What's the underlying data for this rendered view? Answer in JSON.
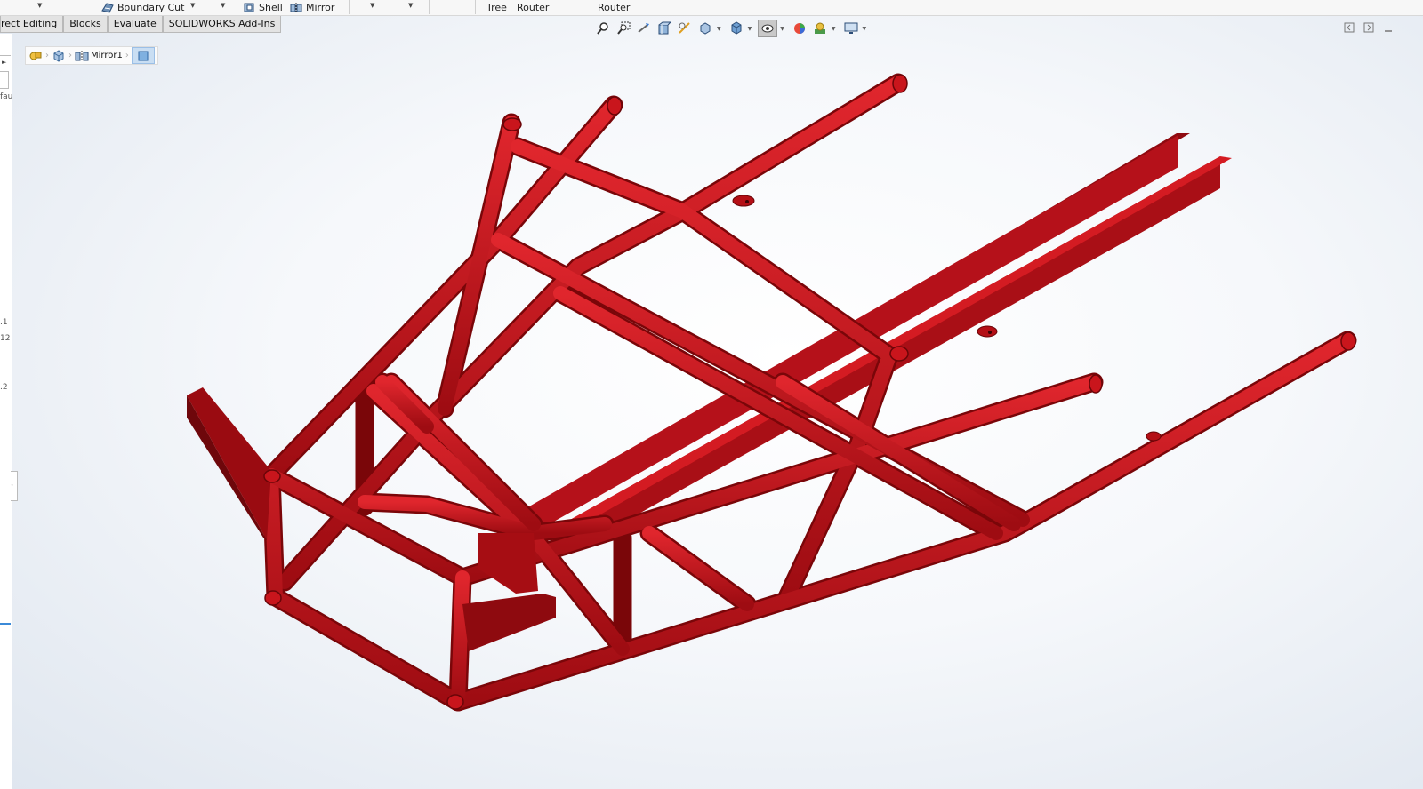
{
  "ribbon": {
    "boundary_cut": "Boundary Cut",
    "shell": "Shell",
    "mirror": "Mirror",
    "tree": "Tree",
    "router1": "Router",
    "router2": "Router"
  },
  "tabs": [
    "rect Editing",
    "Blocks",
    "Evaluate",
    "SOLIDWORKS Add-Ins"
  ],
  "breadcrumb": {
    "feature": "Mirror1"
  },
  "left_panel_marks": [
    "fau",
    ".1",
    "12",
    ".2"
  ],
  "hud_icons": [
    "zoom-to-fit-icon",
    "zoom-to-area-icon",
    "previous-view-icon",
    "section-view-icon",
    "dynamic-annotation-icon",
    "view-orientation-icon",
    "display-style-icon",
    "hide-show-items-icon",
    "edit-appearance-icon",
    "apply-scene-icon",
    "view-settings-icon"
  ],
  "colors": {
    "frame_red": "#c8141b",
    "frame_dark": "#8a0a0e",
    "accent_blue": "#3b8ad8"
  }
}
